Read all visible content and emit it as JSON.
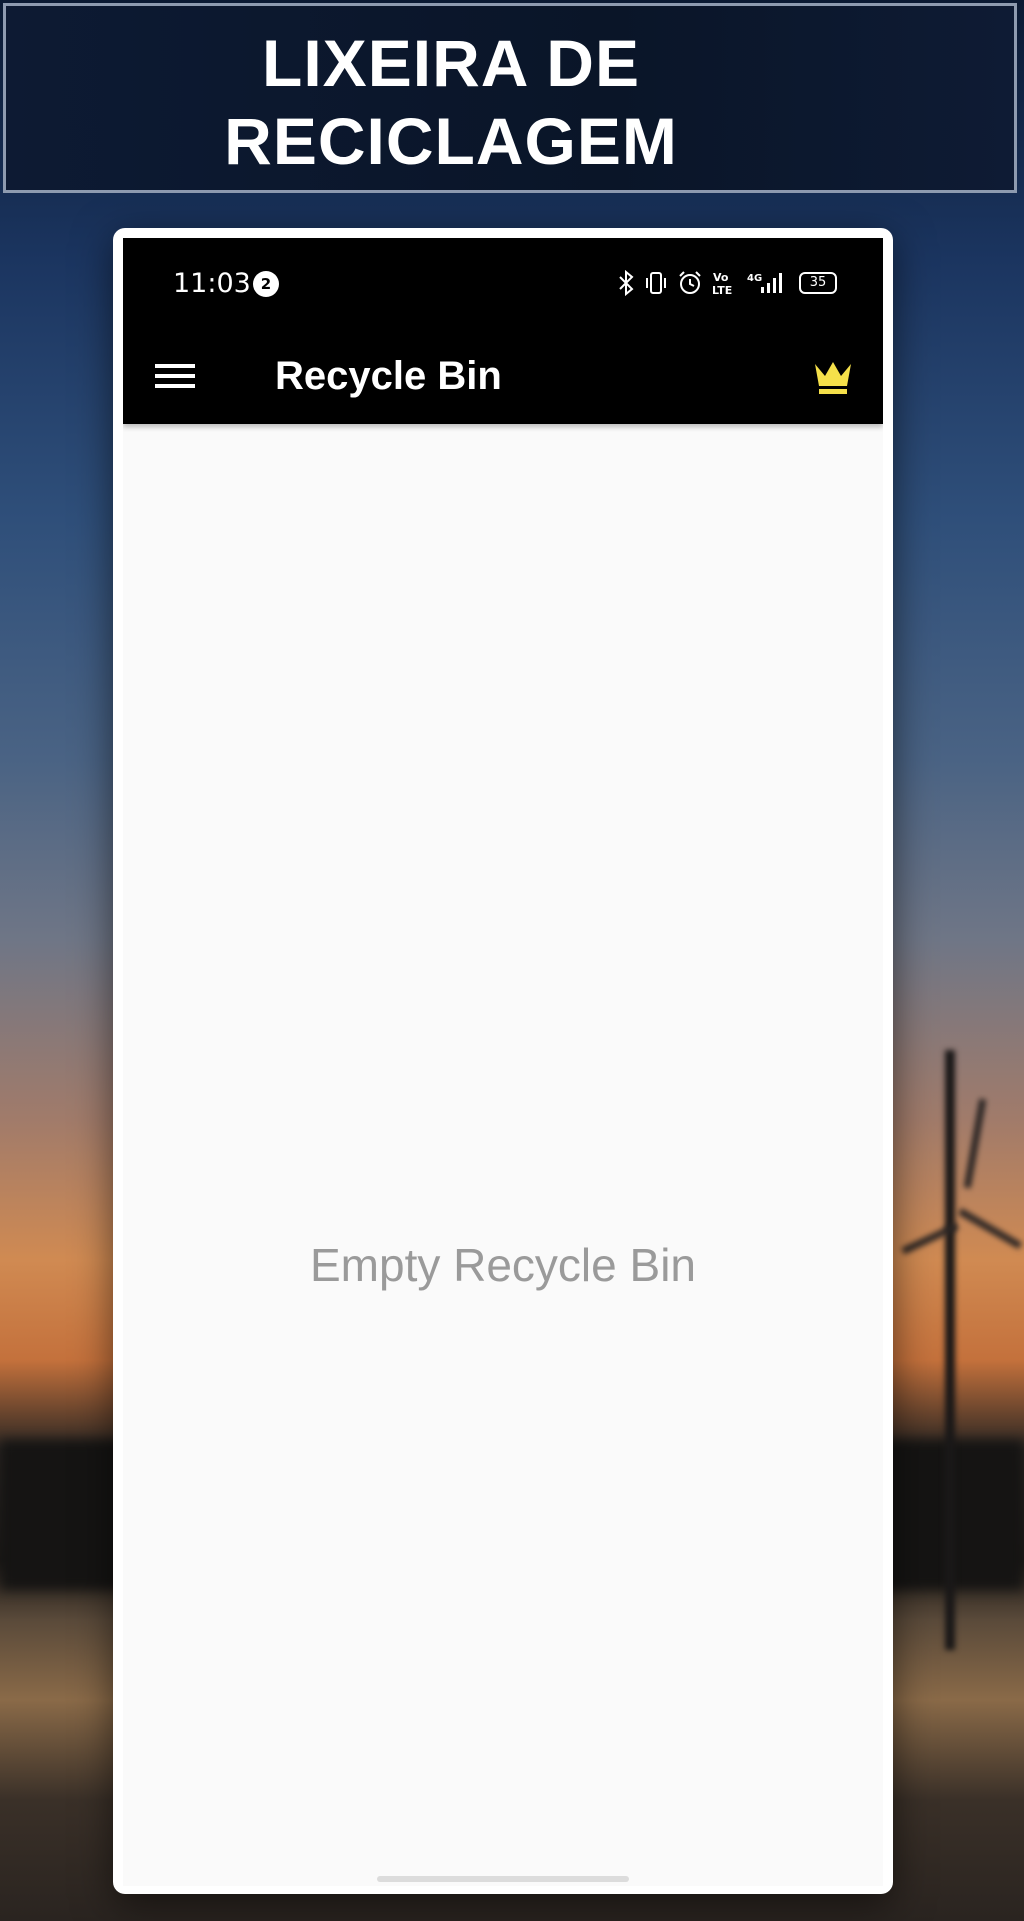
{
  "banner": {
    "title": "LIXEIRA DE\nRECICLAGEM"
  },
  "status_bar": {
    "time": "11:03",
    "notification_count": "2",
    "battery_level": "35",
    "icons": [
      "bluetooth-icon",
      "vibrate-icon",
      "alarm-icon",
      "volte-icon",
      "signal-4g-icon",
      "battery-icon"
    ]
  },
  "app_bar": {
    "title": "Recycle Bin",
    "menu_icon": "hamburger-menu-icon",
    "premium_icon": "crown-icon"
  },
  "main": {
    "empty_message": "Empty Recycle Bin"
  },
  "colors": {
    "app_bar_background": "#000000",
    "crown": "#f5e04a",
    "empty_text": "#9a9a9a",
    "screen_background": "#fafafa"
  }
}
